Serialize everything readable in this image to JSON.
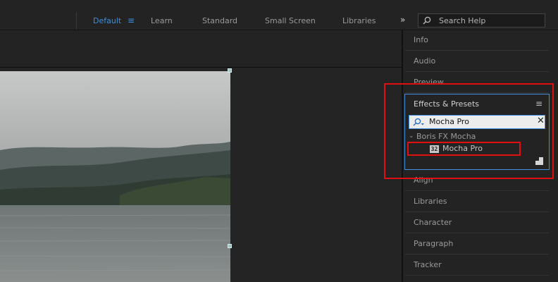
{
  "workspaces": {
    "items": [
      "Default",
      "Learn",
      "Standard",
      "Small Screen",
      "Libraries"
    ],
    "active": "Default",
    "overflow": "»",
    "menu_icon": "hamburger-menu-icon"
  },
  "search_help": {
    "placeholder": "Search Help",
    "icon": "search-icon"
  },
  "right_panels": {
    "tabs_top": [
      "Info",
      "Audio",
      "Preview"
    ],
    "tabs_bottom": [
      "Align",
      "Libraries",
      "Character",
      "Paragraph",
      "Tracker"
    ]
  },
  "effects_presets": {
    "title": "Effects & Presets",
    "menu_icon": "≡",
    "search_value": "Mocha Pro",
    "clear_icon": "✕",
    "category": "Boris FX Mocha",
    "category_toggle": "⌄",
    "effect_badge": "32",
    "effect_name": "Mocha Pro"
  },
  "colors": {
    "accent": "#3f8ee0",
    "highlight": "#e01010"
  }
}
